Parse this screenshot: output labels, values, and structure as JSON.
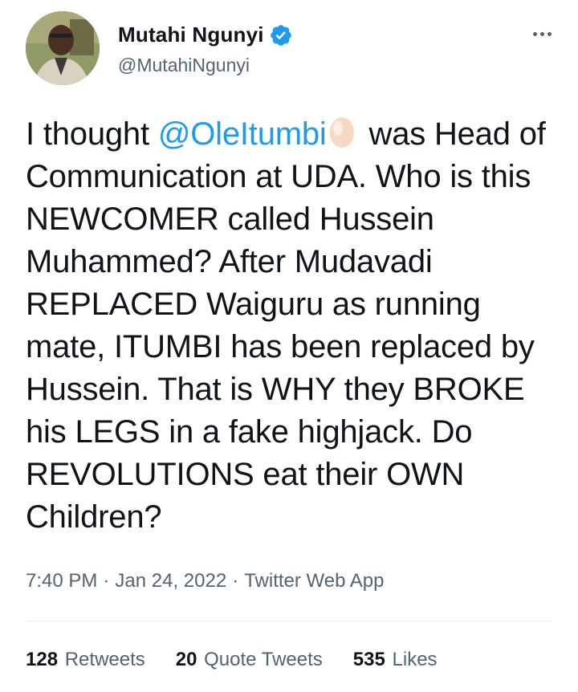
{
  "author": {
    "display_name": "Mutahi Ngunyi",
    "handle": "@MutahiNgunyi",
    "verified_icon": "verified-badge-icon",
    "avatar_icon": "profile-photo"
  },
  "more_icon": "more-options-icon",
  "tweet": {
    "part1": "I thought ",
    "mention": "@OleItumbi",
    "emoji_icon": "egg-emoji",
    "part2": " was Head of Communication at UDA. Who is this NEWCOMER called Hussein Muhammed? After Mudavadi REPLACED Waiguru as running mate, ITUMBI has been replaced by Hussein. That is WHY they BROKE his LEGS in a fake highjack. Do REVOLUTIONS eat their OWN Children?"
  },
  "meta": {
    "time": "7:40 PM",
    "separator": "·",
    "date": "Jan 24, 2022",
    "source": "Twitter Web App"
  },
  "stats": {
    "retweets_count": "128",
    "retweets_label": "Retweets",
    "quotes_count": "20",
    "quotes_label": "Quote Tweets",
    "likes_count": "535",
    "likes_label": "Likes"
  },
  "colors": {
    "link": "#1d9bf0",
    "secondary_text": "#536471",
    "primary_text": "#0f1419"
  }
}
